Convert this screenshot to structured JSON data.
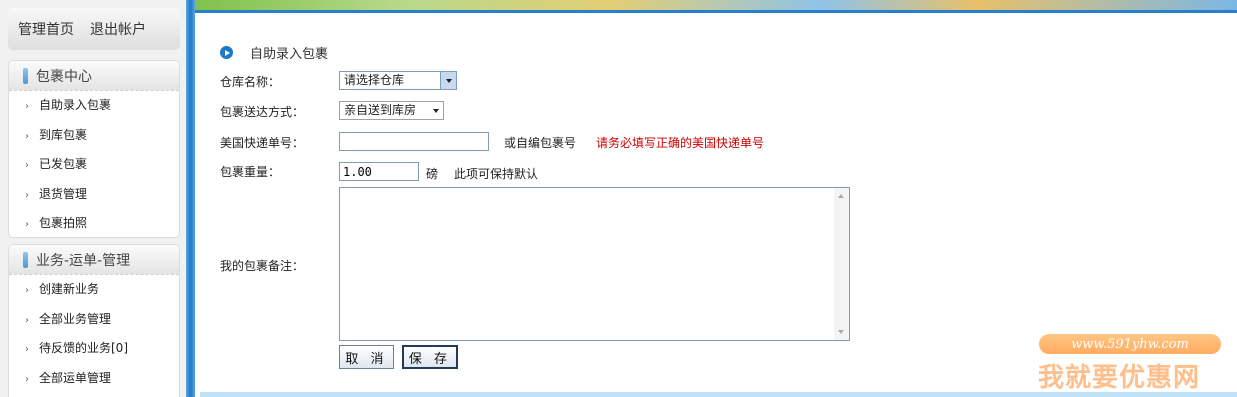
{
  "topnav": {
    "home": "管理首页",
    "logout": "退出帐户"
  },
  "sidebar": {
    "section1": {
      "title": "包裹中心",
      "items": [
        "自助录入包裹",
        "到库包裹",
        "已发包裹",
        "退货管理",
        "包裹拍照"
      ]
    },
    "section2": {
      "title": "业务-运单-管理",
      "items": [
        "创建新业务",
        "全部业务管理",
        "待反馈的业务[0]",
        "全部运单管理"
      ]
    }
  },
  "main": {
    "title": "自助录入包裹",
    "warehouse": {
      "label": "仓库名称：",
      "value": "请选择仓库"
    },
    "delivery": {
      "label": "包裹送达方式：",
      "value": "亲自送到库房"
    },
    "tracking": {
      "label": "美国快递单号：",
      "value": "",
      "alt_label": "或自编包裹号",
      "warning": "请务必填写正确的美国快递单号"
    },
    "weight": {
      "label": "包裹重量：",
      "value": "1.00",
      "unit": "磅",
      "hint": "此项可保持默认"
    },
    "remark": {
      "label": "我的包裹备注：",
      "value": ""
    },
    "cancel_label": "取 消",
    "save_label": "保 存"
  },
  "watermark": {
    "url": "www.591yhw.com",
    "text": "我就要优惠网"
  },
  "colors": {
    "accent": "#1e78c8",
    "warning": "#cc0000"
  }
}
